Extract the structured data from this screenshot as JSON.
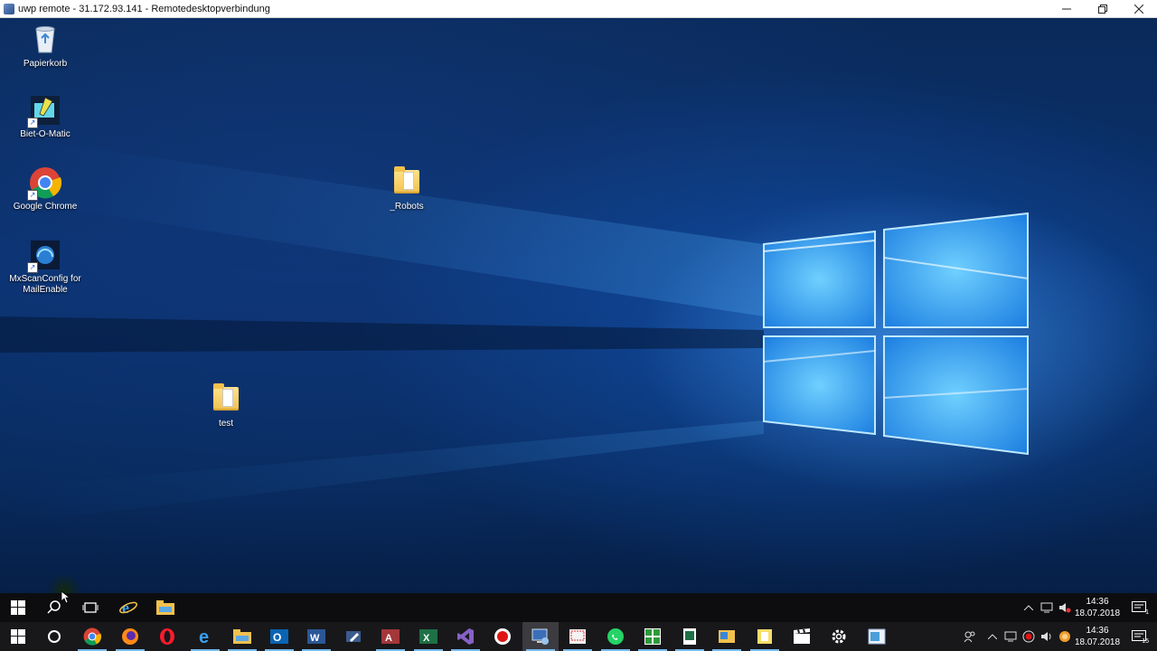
{
  "window": {
    "title": "uwp remote - 31.172.93.141 - Remotedesktopverbindung",
    "controls": [
      "minimize",
      "restore",
      "close"
    ]
  },
  "desktop": {
    "icons": [
      {
        "label": "Papierkorb",
        "icon": "recycle-bin-icon"
      },
      {
        "label": "Biet-O-Matic",
        "icon": "biet-o-matic-icon"
      },
      {
        "label": "Google Chrome",
        "icon": "chrome-icon"
      },
      {
        "label": "MxScanConfig for MailEnable",
        "icon": "mailenable-icon"
      },
      {
        "label": "_Robots",
        "icon": "folder-icon"
      },
      {
        "label": "test",
        "icon": "folder-icon"
      }
    ]
  },
  "remote_taskbar": {
    "items": [
      "start",
      "search",
      "task-view",
      "internet-explorer",
      "file-explorer"
    ],
    "clock": {
      "time": "14:36",
      "date": "18.07.2018"
    },
    "notification_count": "1"
  },
  "local_taskbar": {
    "items": [
      "start",
      "cortana",
      "chrome",
      "firefox",
      "opera",
      "edge",
      "file-explorer",
      "outlook",
      "word",
      "pen-tool",
      "access",
      "excel",
      "visual-studio",
      "record",
      "remote-desktop",
      "snipping",
      "whatsapp",
      "grid-app",
      "spreadsheet-app",
      "image-app",
      "sticky-app",
      "clapper",
      "settings",
      "window-app"
    ],
    "clock": {
      "time": "14:36",
      "date": "18.07.2018"
    },
    "notification_count": "15"
  },
  "colors": {
    "accent": "#76b9ed",
    "taskbar": "#18181b",
    "desktop": "#0a3270"
  }
}
